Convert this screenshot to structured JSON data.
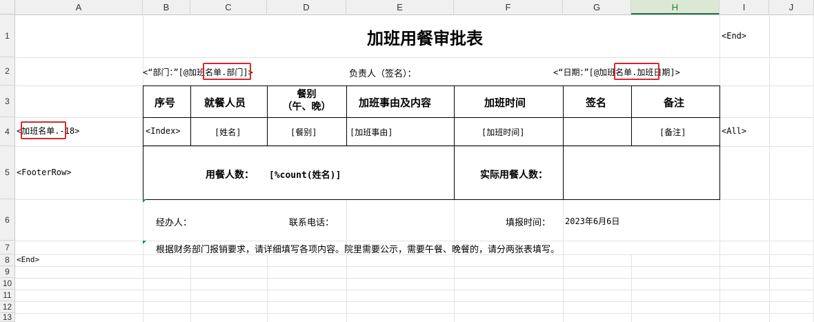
{
  "columns": [
    "A",
    "B",
    "C",
    "D",
    "E",
    "F",
    "G",
    "H",
    "I",
    "J"
  ],
  "selected_column": "H",
  "rows": [
    "1",
    "2",
    "3",
    "4",
    "5",
    "6",
    "7",
    "8",
    "9",
    "10",
    "11",
    "12",
    "13"
  ],
  "sheet": {
    "title": "加班用餐审批表",
    "end_tag_i1": "<End>",
    "dept_prefix": "<“部门：”[@",
    "dept_field": "加班名单",
    "dept_suffix": ".部门]>",
    "owner_label": "负责人（签名）：",
    "date_prefix": "<“日期：”[@",
    "date_field": "加班名单",
    "date_suffix": ".加班日期]>",
    "headers": [
      "序号",
      "就餐人员",
      "餐别\n（午、晚）",
      "加班事由及内容",
      "加班时间",
      "签名",
      "备注"
    ],
    "range_prefix": "<",
    "range_field": "加班名单",
    "range_suffix": ".-18>",
    "data_row": [
      "<Index>",
      "[姓名]",
      "[餐别]",
      "[加班事由]",
      "[加班时间]",
      "",
      "[备注]"
    ],
    "all_tag": "<All>",
    "footer_row_tag": "<FooterRow>",
    "diners_label": "用餐人数：",
    "diners_value": "[%count(姓名)]",
    "actual_label": "实际用餐人数：",
    "handler_label": "经办人：",
    "phone_label": "联系电话：",
    "report_time_label": "填报时间：",
    "report_time_value": "2023年6月6日",
    "note": "根据财务部门报销要求，请详细填写各项内容。院里需要公示，需要午餐、晚餐的，请分两张表填写。",
    "end_tag_a8": "<End>"
  }
}
